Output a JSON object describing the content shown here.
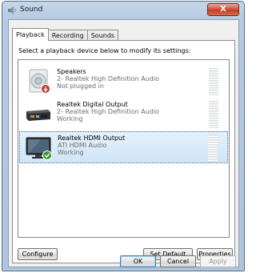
{
  "window": {
    "title": "Sound",
    "close_label": "X"
  },
  "tabs": [
    {
      "label": "Playback",
      "active": true
    },
    {
      "label": "Recording",
      "active": false
    },
    {
      "label": "Sounds",
      "active": false
    }
  ],
  "instruction": "Select a playback device below to modify its settings:",
  "devices": [
    {
      "name": "Speakers",
      "description": "2- Realtek High Definition Audio",
      "status": "Not plugged in",
      "icon": "speaker-icon",
      "badge": "unplugged-badge-icon",
      "selected": false
    },
    {
      "name": "Realtek Digital Output",
      "description": "2- Realtek High Definition Audio",
      "status": "Working",
      "icon": "digital-output-icon",
      "badge": "",
      "selected": false
    },
    {
      "name": "Realtek HDMI Output",
      "description": "ATI HDMI Audio",
      "status": "Working",
      "icon": "monitor-icon",
      "badge": "default-check-badge-icon",
      "selected": true
    }
  ],
  "buttons": {
    "configure": "Configure",
    "set_default": "Set Default",
    "properties": "Properties",
    "ok": "OK",
    "cancel": "Cancel",
    "apply": "Apply"
  },
  "colors": {
    "selection_border": "#4a6c8c",
    "badge_red": "#c0392b",
    "badge_green": "#3a9a2e"
  }
}
